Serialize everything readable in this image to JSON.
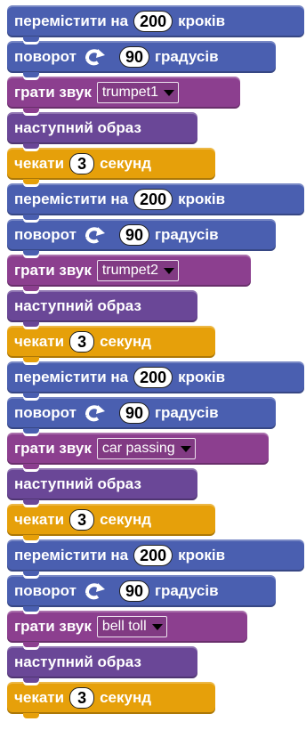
{
  "blocks": [
    {
      "kind": "move",
      "pre": "перемістити на",
      "num": "200",
      "post": "кроків"
    },
    {
      "kind": "turn",
      "pre": "поворот",
      "num": "90",
      "post": "градусів"
    },
    {
      "kind": "sound",
      "pre": "грати звук",
      "option": "trumpet1"
    },
    {
      "kind": "looks",
      "label": "наступний образ"
    },
    {
      "kind": "wait",
      "pre": "чекати",
      "num": "3",
      "post": "секунд"
    },
    {
      "kind": "move",
      "pre": "перемістити на",
      "num": "200",
      "post": "кроків"
    },
    {
      "kind": "turn",
      "pre": "поворот",
      "num": "90",
      "post": "градусів"
    },
    {
      "kind": "sound",
      "pre": "грати звук",
      "option": "trumpet2"
    },
    {
      "kind": "looks",
      "label": "наступний образ"
    },
    {
      "kind": "wait",
      "pre": "чекати",
      "num": "3",
      "post": "секунд"
    },
    {
      "kind": "move",
      "pre": "перемістити на",
      "num": "200",
      "post": "кроків"
    },
    {
      "kind": "turn",
      "pre": "поворот",
      "num": "90",
      "post": "градусів"
    },
    {
      "kind": "sound",
      "pre": "грати звук",
      "option": "car passing"
    },
    {
      "kind": "looks",
      "label": "наступний образ"
    },
    {
      "kind": "wait",
      "pre": "чекати",
      "num": "3",
      "post": "секунд"
    },
    {
      "kind": "move",
      "pre": "перемістити на",
      "num": "200",
      "post": "кроків"
    },
    {
      "kind": "turn",
      "pre": "поворот",
      "num": "90",
      "post": "градусів"
    },
    {
      "kind": "sound",
      "pre": "грати звук",
      "option": "bell toll"
    },
    {
      "kind": "looks",
      "label": "наступний образ"
    },
    {
      "kind": "wait",
      "pre": "чекати",
      "num": "3",
      "post": "секунд"
    }
  ],
  "icons": {
    "turn": "rotate-clockwise-icon",
    "dropdown": "dropdown-arrow-icon"
  },
  "colors": {
    "motion": "#4a5fb0",
    "sound": "#8c3f8f",
    "looks": "#6a4797",
    "control": "#e6a00a"
  }
}
